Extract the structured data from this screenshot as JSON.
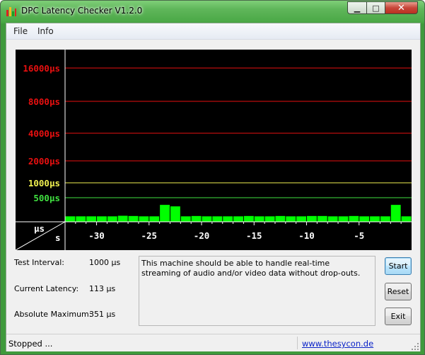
{
  "window": {
    "title": "DPC Latency Checker V1.2.0",
    "close_glyph": "✕",
    "min_glyph": "▁",
    "max_glyph": "□"
  },
  "menu": {
    "file": "File",
    "info": "Info"
  },
  "chart": {
    "corner_top": "µs",
    "corner_bottom": "s",
    "levels": [
      {
        "label": "16000µs",
        "value": 16000,
        "color": "#e81010"
      },
      {
        "label": "8000µs",
        "value": 8000,
        "color": "#e81010"
      },
      {
        "label": "4000µs",
        "value": 4000,
        "color": "#e81010"
      },
      {
        "label": "2000µs",
        "value": 2000,
        "color": "#e81010"
      },
      {
        "label": "1000µs",
        "value": 1000,
        "color": "#f0f050"
      },
      {
        "label": "500µs",
        "value": 500,
        "color": "#40e040"
      }
    ],
    "x_ticks": [
      "-30",
      "-25",
      "-20",
      "-15",
      "-10",
      "-5"
    ],
    "bar_color": "#00ff00"
  },
  "chart_data": {
    "type": "bar",
    "title": "",
    "xlabel": "s",
    "ylabel": "µs",
    "x_range": [
      -33,
      0
    ],
    "x": [
      -32.5,
      -31.5,
      -30.5,
      -29.5,
      -28.5,
      -27.5,
      -26.5,
      -25.5,
      -24.5,
      -23.5,
      -22.5,
      -21.5,
      -20.5,
      -19.5,
      -18.5,
      -17.5,
      -16.5,
      -15.5,
      -14.5,
      -13.5,
      -12.5,
      -11.5,
      -10.5,
      -9.5,
      -8.5,
      -7.5,
      -6.5,
      -5.5,
      -4.5,
      -3.5,
      -2.5,
      -1.5,
      -0.5
    ],
    "values": [
      113,
      113,
      113,
      113,
      113,
      125,
      120,
      113,
      113,
      351,
      320,
      113,
      120,
      113,
      113,
      113,
      113,
      120,
      113,
      113,
      120,
      113,
      113,
      120,
      120,
      113,
      113,
      120,
      113,
      113,
      113,
      351,
      113
    ],
    "y_levels": [
      500,
      1000,
      2000,
      4000,
      8000,
      16000
    ]
  },
  "info": {
    "test_interval_label": "Test Interval:",
    "test_interval_value": "1000 µs",
    "current_latency_label": "Current Latency:",
    "current_latency_value": "113 µs",
    "absolute_max_label": "Absolute Maximum:",
    "absolute_max_value": "351 µs"
  },
  "message": "This machine should be able to handle real-time streaming of audio and/or video data without drop-outs.",
  "buttons": {
    "start": "Start",
    "reset": "Reset",
    "exit": "Exit"
  },
  "status": {
    "text": "Stopped ...",
    "link": "www.thesycon.de"
  }
}
